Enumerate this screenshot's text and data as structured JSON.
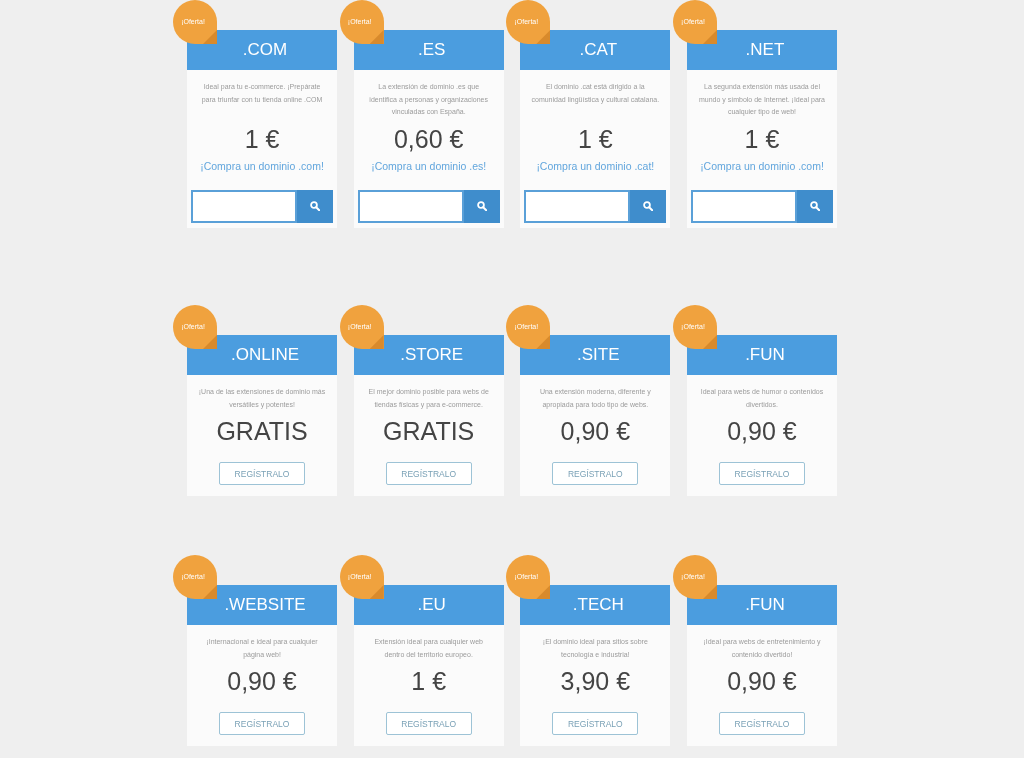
{
  "sections": [
    {
      "cards": [
        {
          "badge": "¡Oferta!",
          "name": ".COM",
          "description": "Ideal para tu e-commerce. ¡Prepárate para triunfar con tu tienda online .COM",
          "price": "1 €",
          "kind": "search",
          "link": "¡Compra un dominio .com!"
        },
        {
          "badge": "¡Oferta!",
          "name": ".ES",
          "description": "La extensión de dominio .es que identifica a personas y organizaciones vinculadas con España.",
          "price": "0,60 €",
          "kind": "search",
          "link": "¡Compra un dominio .es!"
        },
        {
          "badge": "¡Oferta!",
          "name": ".CAT",
          "description": "El dominio .cat está dirigido a la comunidad lingüística y cultural catalana.",
          "price": "1 €",
          "kind": "search",
          "link": "¡Compra un dominio .cat!"
        },
        {
          "badge": "¡Oferta!",
          "name": ".NET",
          "description": "La segunda extensión más usada del mundo y símbolo de Internet. ¡Ideal para cualquier tipo de web!",
          "price": "1 €",
          "kind": "search",
          "link": "¡Compra un dominio .com!"
        }
      ]
    },
    {
      "cards": [
        {
          "badge": "¡Oferta!",
          "name": ".ONLINE",
          "description": "¡Una de las extensiones de dominio más versátiles y potentes!",
          "price": "GRATIS",
          "kind": "register",
          "button": "REGÍSTRALO"
        },
        {
          "badge": "¡Oferta!",
          "name": ".STORE",
          "description": "El mejor dominio posible para webs de tiendas físicas y para e-commerce.",
          "price": "GRATIS",
          "kind": "register",
          "button": "REGÍSTRALO"
        },
        {
          "badge": "¡Oferta!",
          "name": ".SITE",
          "description": "Una extensión moderna, diferente y apropiada para todo tipo de webs.",
          "price": "0,90 €",
          "kind": "register",
          "button": "REGÍSTRALO"
        },
        {
          "badge": "¡Oferta!",
          "name": ".FUN",
          "description": "Ideal para webs de humor o contenidos divertidos.",
          "price": "0,90 €",
          "kind": "register",
          "button": "REGÍSTRALO"
        }
      ]
    },
    {
      "cards": [
        {
          "badge": "¡Oferta!",
          "name": ".WEBSITE",
          "description": "¡Internacional e ideal para cualquier página web!",
          "price": "0,90 €",
          "kind": "register",
          "button": "REGÍSTRALO"
        },
        {
          "badge": "¡Oferta!",
          "name": ".EU",
          "description": "Extensión ideal para cualquier web dentro del territorio europeo.",
          "price": "1 €",
          "kind": "register",
          "button": "REGÍSTRALO"
        },
        {
          "badge": "¡Oferta!",
          "name": ".TECH",
          "description": "¡El dominio ideal para sitios sobre tecnología e industria!",
          "price": "3,90 €",
          "kind": "register",
          "button": "REGÍSTRALO"
        },
        {
          "badge": "¡Oferta!",
          "name": ".FUN",
          "description": "¡Ideal para webs de entretenimiento y contenido divertido!",
          "price": "0,90 €",
          "kind": "register",
          "button": "REGÍSTRALO"
        }
      ]
    }
  ]
}
